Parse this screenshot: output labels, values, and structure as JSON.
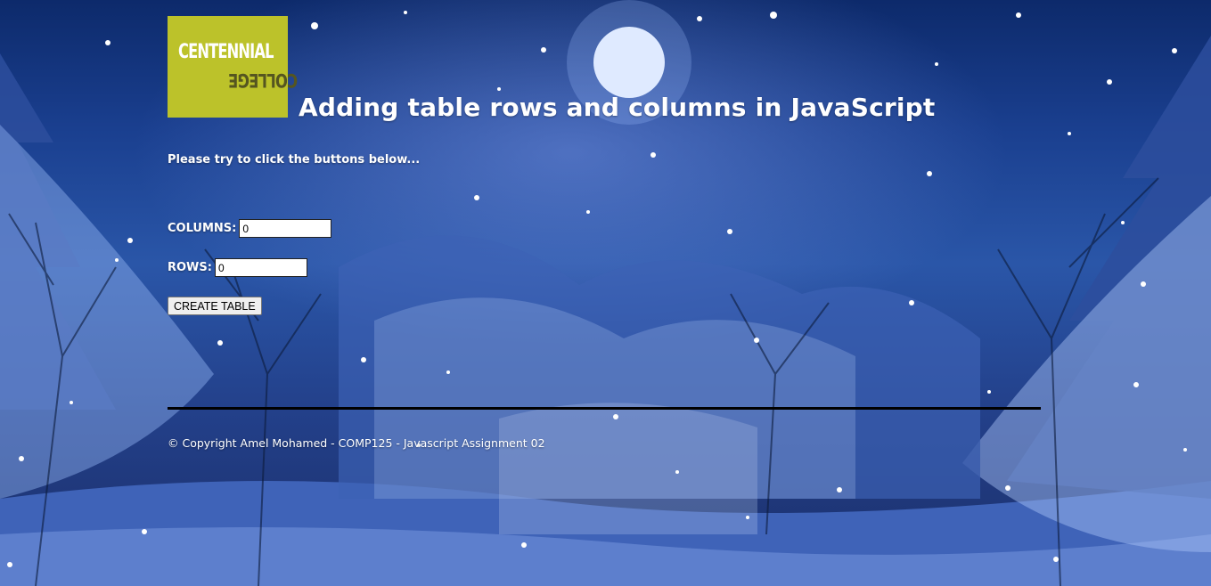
{
  "logo": {
    "line1": "CENTENNIAL",
    "line2": "COLLEGE",
    "color": "#bcc22a"
  },
  "header": {
    "title": "Adding table rows and columns in JavaScript"
  },
  "main": {
    "instruction": "Please try to click the buttons below...",
    "columns_label": "COLUMNS:",
    "columns_value": "0",
    "rows_label": "ROWS:",
    "rows_value": "0",
    "create_button_label": "CREATE TABLE"
  },
  "footer": {
    "text": "© Copyright Amel Mohamed - COMP125 - Javascript Assignment 02"
  },
  "background": {
    "theme": "snowy-forest-night-with-moon",
    "sky_color": "#1a3f8f"
  }
}
